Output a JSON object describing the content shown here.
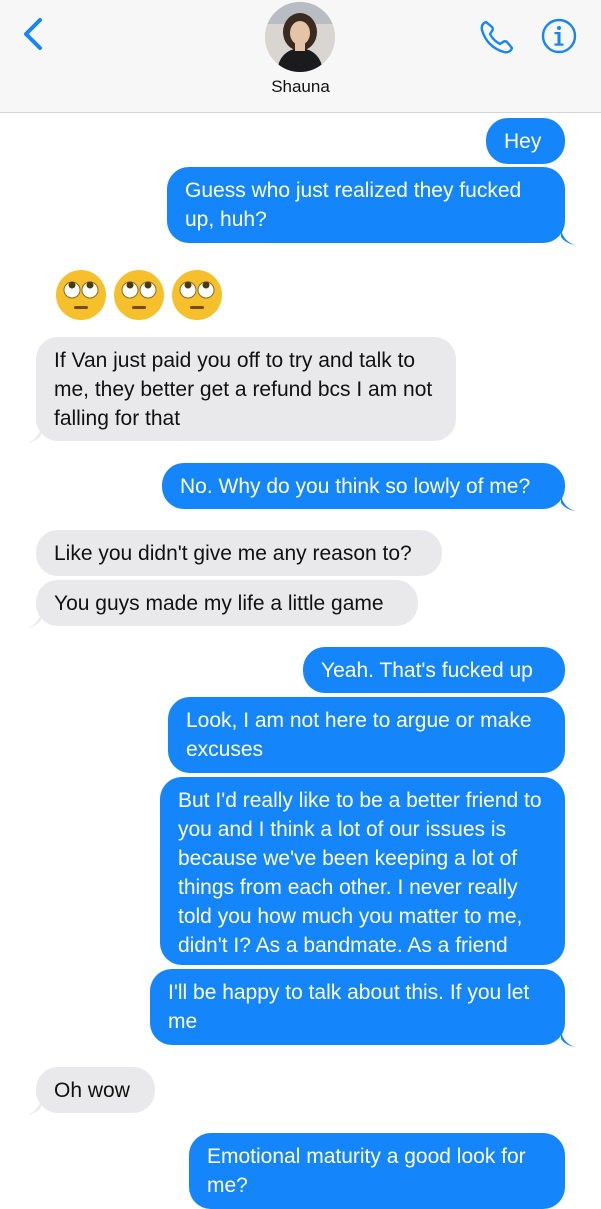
{
  "header": {
    "contact_name": "Shauna"
  },
  "icons": {
    "back": "chevron-left-icon",
    "phone": "phone-icon",
    "info": "info-icon",
    "emoji": "face-with-rolling-eyes"
  },
  "colors": {
    "accent": "#1585fb",
    "received_bubble": "#e9e9eb",
    "header_bg": "#f7f7f8"
  },
  "messages": [
    {
      "from": "me",
      "text": "Hey"
    },
    {
      "from": "me",
      "text": "Guess who just realized they fucked up, huh?"
    },
    {
      "from": "them",
      "text": "🙄🙄🙄"
    },
    {
      "from": "them",
      "text": "If Van just paid you off to try and talk to me, they better get a refund bcs I am not falling for that"
    },
    {
      "from": "me",
      "text": "No. Why do you think so lowly of me?"
    },
    {
      "from": "them",
      "text": "Like you didn't give me any reason to?"
    },
    {
      "from": "them",
      "text": "You guys made my life a little game"
    },
    {
      "from": "me",
      "text": "Yeah. That's fucked up"
    },
    {
      "from": "me",
      "text": "Look, I am not here to argue or make excuses"
    },
    {
      "from": "me",
      "text": "But I'd really like to be a better friend to you and I think a lot of our issues is because we've been keeping a lot of things from each other. I never really told you how much you matter to me, didn't I? As a bandmate. As a friend"
    },
    {
      "from": "me",
      "text": "I'll be happy to talk about this. If you let me"
    },
    {
      "from": "them",
      "text": "Oh wow"
    },
    {
      "from": "me",
      "text": "Emotional maturity a good look for me?"
    }
  ]
}
